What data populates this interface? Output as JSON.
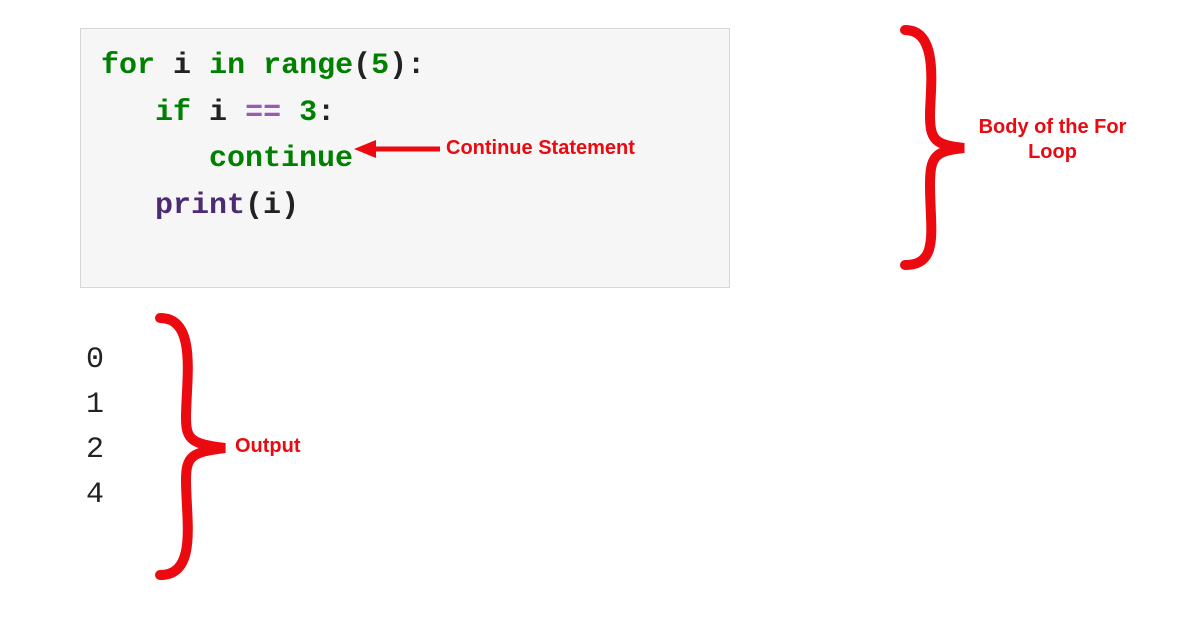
{
  "code": {
    "line1": {
      "for": "for",
      "var1": "i",
      "in": "in",
      "range": "range",
      "lp": "(",
      "arg": "5",
      "rp": ")",
      "colon": ":"
    },
    "line2": {
      "if": "if",
      "var": "i",
      "op": "==",
      "val": "3",
      "colon": ":"
    },
    "line3": {
      "continue": "continue"
    },
    "line4": {
      "print": "print",
      "lp": "(",
      "arg": "i",
      "rp": ")"
    }
  },
  "output_lines": {
    "l0": "0",
    "l1": "1",
    "l2": "2",
    "l3": "4"
  },
  "annotations": {
    "continue_label": "Continue Statement",
    "body_label": "Body of the For Loop",
    "output_label": "Output"
  },
  "colors": {
    "red": "#ea0a0f"
  }
}
